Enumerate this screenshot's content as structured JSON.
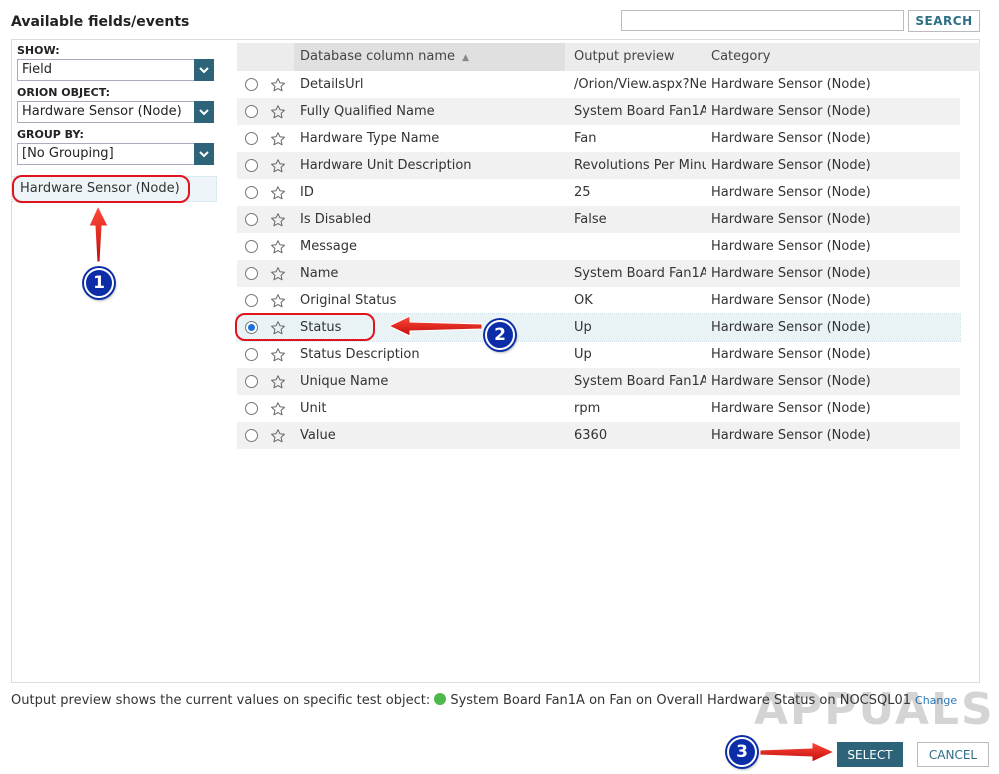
{
  "header": {
    "title": "Available fields/events",
    "search_placeholder": "",
    "search_button": "SEARCH"
  },
  "left_panel": {
    "show_label": "SHOW:",
    "show_value": "Field",
    "object_label": "ORION OBJECT:",
    "object_value": "Hardware Sensor (Node)",
    "group_label": "GROUP BY:",
    "group_value": "[No Grouping]",
    "group_item": "Hardware Sensor (Node)"
  },
  "grid": {
    "columns": {
      "name": "Database column name",
      "preview": "Output preview",
      "category": "Category"
    },
    "rows": [
      {
        "name": "DetailsUrl",
        "preview": "/Orion/View.aspx?Ne",
        "category": "Hardware Sensor (Node)",
        "selected": false
      },
      {
        "name": "Fully Qualified Name",
        "preview": "System Board Fan1A",
        "category": "Hardware Sensor (Node)",
        "selected": false
      },
      {
        "name": "Hardware Type Name",
        "preview": "Fan",
        "category": "Hardware Sensor (Node)",
        "selected": false
      },
      {
        "name": "Hardware Unit Description",
        "preview": "Revolutions Per Minu",
        "category": "Hardware Sensor (Node)",
        "selected": false
      },
      {
        "name": "ID",
        "preview": "25",
        "category": "Hardware Sensor (Node)",
        "selected": false
      },
      {
        "name": "Is Disabled",
        "preview": "False",
        "category": "Hardware Sensor (Node)",
        "selected": false
      },
      {
        "name": "Message",
        "preview": "",
        "category": "Hardware Sensor (Node)",
        "selected": false
      },
      {
        "name": "Name",
        "preview": "System Board Fan1A",
        "category": "Hardware Sensor (Node)",
        "selected": false
      },
      {
        "name": "Original Status",
        "preview": "OK",
        "category": "Hardware Sensor (Node)",
        "selected": false
      },
      {
        "name": "Status",
        "preview": "Up",
        "category": "Hardware Sensor (Node)",
        "selected": true
      },
      {
        "name": "Status Description",
        "preview": "Up",
        "category": "Hardware Sensor (Node)",
        "selected": false
      },
      {
        "name": "Unique Name",
        "preview": "System Board Fan1A",
        "category": "Hardware Sensor (Node)",
        "selected": false
      },
      {
        "name": "Unit",
        "preview": "rpm",
        "category": "Hardware Sensor (Node)",
        "selected": false
      },
      {
        "name": "Value",
        "preview": "6360",
        "category": "Hardware Sensor (Node)",
        "selected": false
      }
    ]
  },
  "footer": {
    "note": "Output preview shows the current values on specific test object:",
    "object": "System Board Fan1A on Fan on Overall Hardware Status on NOCSQL01",
    "change_link": "Change",
    "status_color": "#4fb84a"
  },
  "buttons": {
    "select": "SELECT",
    "cancel": "CANCEL"
  },
  "annotations": {
    "step1": "1",
    "step2": "2",
    "step3": "3",
    "watermark": "APPUALS"
  },
  "colors": {
    "accent": "#2d6479",
    "annotation": "#e0141e",
    "badge": "#0b2ea8"
  }
}
